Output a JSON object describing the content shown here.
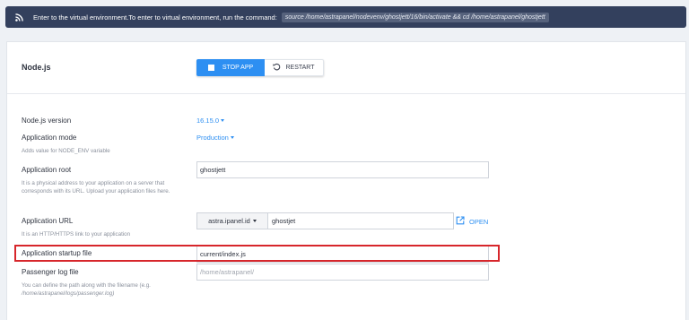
{
  "banner": {
    "icon": "rss-icon",
    "text": "Enter to the virtual environment.To enter to virtual environment, run the command:",
    "command": "source /home/astrapanel/nodevenv/ghostjett/16/bin/activate && cd /home/astrapanel/ghostjett"
  },
  "app": {
    "title": "Node.js",
    "stop_label": "STOP APP",
    "restart_label": "RESTART"
  },
  "form": {
    "nodejs_version": {
      "label": "Node.js version",
      "value": "16.15.0"
    },
    "app_mode": {
      "label": "Application mode",
      "value": "Production",
      "hint": "Adds value for NODE_ENV variable"
    },
    "app_root": {
      "label": "Application root",
      "value": "ghostjett",
      "hint": "It is a physical address to your application on a server that corresponds with its URL. Upload your application files here."
    },
    "app_url": {
      "label": "Application URL",
      "domain": "astra.ipanel.id",
      "path": "ghostjet",
      "open_label": "OPEN",
      "hint": "It is an HTTP/HTTPS link to your application"
    },
    "startup_file": {
      "label": "Application startup file",
      "value": "current/index.js"
    },
    "passenger_log": {
      "label": "Passenger log file",
      "placeholder": "/home/astrapanel/",
      "hint_prefix": "You can define the path along with the filename (e.g.",
      "hint_example": "/home/astrapanel/logs/passenger.log)"
    }
  },
  "colors": {
    "accent": "#2d8ff2",
    "banner_bg": "#33405d",
    "highlight": "#d7262b"
  }
}
